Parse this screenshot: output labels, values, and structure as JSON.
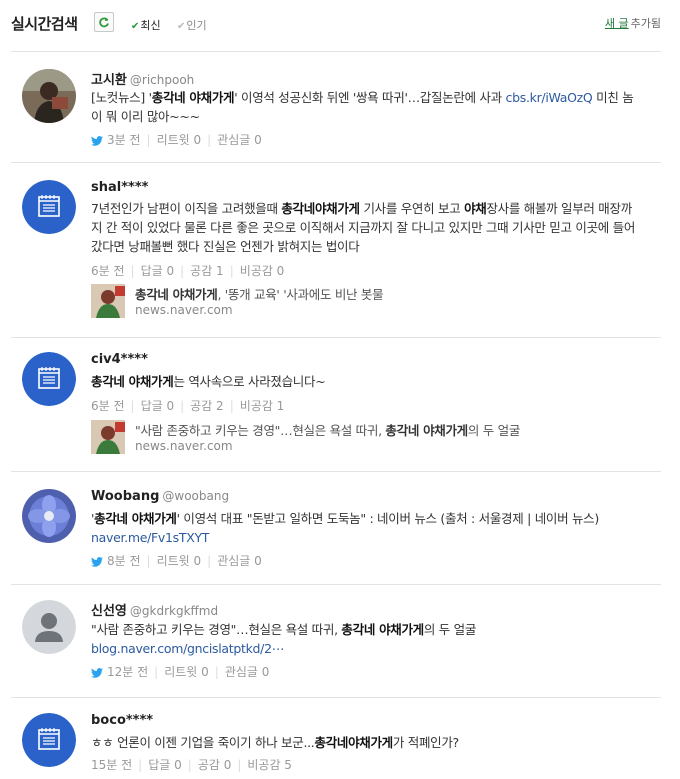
{
  "header": {
    "title": "실시간검색",
    "sort_latest": "최신",
    "sort_popular": "인기",
    "new_link": "새 글",
    "new_suffix": "추가됨"
  },
  "posts": [
    {
      "author": "고시환",
      "handle": "@richpooh",
      "body_parts": [
        "[노컷뉴스] '",
        "총각네 야채가게",
        "' 이영석 성공신화 뒤엔 '쌍욕 따귀'…갑질논란에 사과 ",
        "cbs.kr/iWaOzQ",
        " 미친 놈이 뭐 이리 많아~~~"
      ],
      "meta": {
        "time": "3분 전",
        "m1": "리트윗 0",
        "m2": "관심글 0"
      }
    },
    {
      "author": "shal****",
      "handle": "",
      "body_parts": [
        "7년전인가 남편이 이직을 고려했을때 ",
        "총각네야채가게",
        " 기사를 우연히 보고 ",
        "야채",
        "장사를 해볼까 일부러 매장까지 간 적이 있었다 물론 다른 좋은 곳으로 이직해서 지금까지 잘 다니고 있지만 그때 기사만 믿고 이곳에 들어갔다면 낭패볼뻔 했다 진실은 언젠가 밝혀지는 법이다"
      ],
      "meta": {
        "time": "6분 전",
        "m1": "답글 0",
        "m2": "공감 1",
        "m3": "비공감 0"
      },
      "news": {
        "title_parts": [
          "총각네 야채가게",
          ", '똥개 교육' '사과에도 비난 봇물"
        ],
        "source": "news.naver.com"
      }
    },
    {
      "author": "civ4****",
      "handle": "",
      "body_parts": [
        "",
        "총각네 야채가게",
        "는 역사속으로 사라졌습니다~"
      ],
      "meta": {
        "time": "6분 전",
        "m1": "답글 0",
        "m2": "공감 2",
        "m3": "비공감 1"
      },
      "news": {
        "title_parts": [
          "\"사람 존중하고 키우는 경영\"…현실은 욕설 따귀, ",
          "총각네 야채가게",
          "의 두 얼굴"
        ],
        "source": "news.naver.com"
      }
    },
    {
      "author": "Woobang",
      "handle": "@woobang",
      "body_parts": [
        "'",
        "총각네 야채가게",
        "' 이영석 대표 \"돈받고 일하면 도둑놈\" : 네이버 뉴스 (출처 : 서울경제 | 네이버 뉴스) ",
        "naver.me/Fv1sTXYT"
      ],
      "meta": {
        "time": "8분 전",
        "m1": "리트윗 0",
        "m2": "관심글 0"
      }
    },
    {
      "author": "신선영",
      "handle": "@gkdrkgkffmd",
      "body_parts": [
        "\"사람 존중하고 키우는 경영\"…현실은 욕설 따귀, ",
        "총각네 야채가게",
        "의 두 얼굴 ",
        "blog.naver.com/gncislatptkd/2⋯"
      ],
      "meta": {
        "time": "12분 전",
        "m1": "리트윗 0",
        "m2": "관심글 0"
      }
    },
    {
      "author": "boco****",
      "handle": "",
      "body_parts": [
        "ㅎㅎ 언론이 이젠 기업을 죽이기 하나 보군...",
        "총각네야채가게",
        "가 적폐인가?"
      ],
      "meta": {
        "time": "15분 전",
        "m1": "답글 0",
        "m2": "공감 0",
        "m3": "비공감 5"
      }
    }
  ],
  "colors": {
    "accent": "#1b9c37",
    "link": "#2c5aa0",
    "blog_badge": "#2a62c9"
  }
}
